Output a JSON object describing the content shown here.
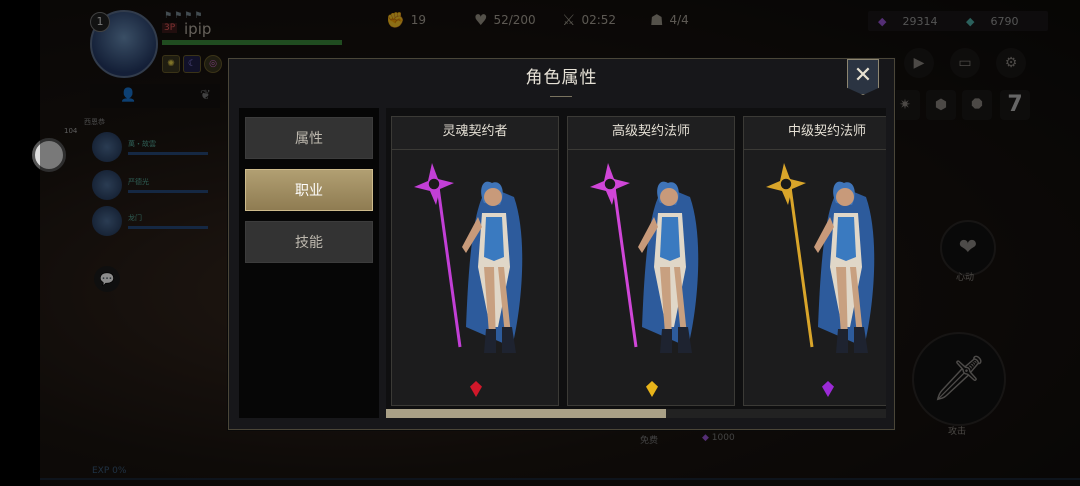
{
  "hud": {
    "level": "1",
    "name_tag": "3P",
    "player_name": "ipip",
    "stats": [
      {
        "icon": "fist-icon",
        "value": "19"
      },
      {
        "icon": "heart-pulse-icon",
        "value": "52/200"
      },
      {
        "icon": "crossed-swords-icon",
        "value": "02:52"
      },
      {
        "icon": "mask-icon",
        "value": "4/4"
      }
    ],
    "currencies": [
      {
        "icon": "purple-gem-icon",
        "value": "29314",
        "color": "#9a55d6"
      },
      {
        "icon": "teal-crystal-icon",
        "value": "6790",
        "color": "#4fb0a8"
      }
    ],
    "party": [
      {
        "name": "萬・故雲"
      },
      {
        "name": "严德光"
      },
      {
        "name": "龙门"
      }
    ],
    "side_label": "西恩恭",
    "side_value": "104",
    "heartbeat_label": "心动",
    "attack_label": "攻击",
    "exp_label": "EXP 0%",
    "cost_label": "免费",
    "cost_value": "1000"
  },
  "modal": {
    "title": "角色属性",
    "close_label": "✕",
    "tabs": [
      {
        "label": "属性",
        "active": false
      },
      {
        "label": "职业",
        "active": true
      },
      {
        "label": "技能",
        "active": false
      }
    ],
    "cards": [
      {
        "title": "灵魂契约者",
        "staff_color": "#c23fd6",
        "gem_color": "#d0182a"
      },
      {
        "title": "高级契约法师",
        "staff_color": "#d046d8",
        "gem_color": "#e8b41a"
      },
      {
        "title": "中级契约法师",
        "staff_color": "#d9a52a",
        "gem_color": "#9b2ad6"
      }
    ],
    "scroll_fraction": 0.56
  }
}
